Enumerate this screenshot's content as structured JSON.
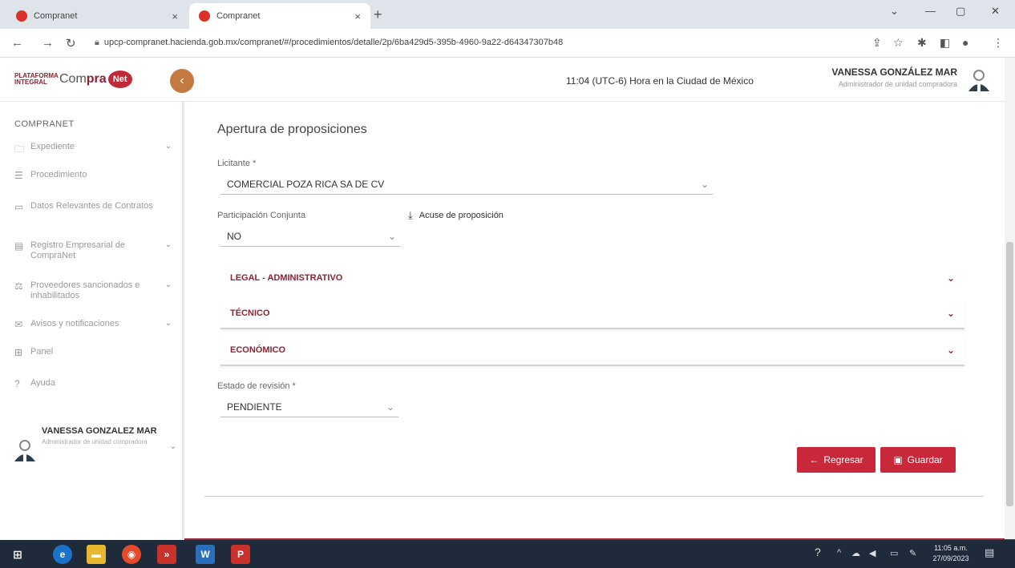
{
  "browser": {
    "tabs": [
      {
        "title": "Compranet",
        "active": false
      },
      {
        "title": "Compranet",
        "active": true
      }
    ],
    "url": "upcp-compranet.hacienda.gob.mx/compranet/#/procedimientos/detalle/2p/6ba429d5-395b-4960-9a22-d64347307b48"
  },
  "header": {
    "logo_plataforma": "PLATAFORMA INTEGRAL",
    "logo_com": "Com",
    "logo_pra": "pra",
    "logo_net": "Net",
    "clock": "11:04 (UTC-6) Hora en la Ciudad de México",
    "user_name": "VANESSA GONZÁLEZ MAR",
    "user_role": "Administrador de unidad compradora"
  },
  "sidebar": {
    "heading": "COMPRANET",
    "items": [
      {
        "label": "Expediente",
        "icon": "folder-icon",
        "chevron": true
      },
      {
        "label": "Procedimiento",
        "icon": "document-icon",
        "chevron": false
      },
      {
        "label": "Datos Relevantes de Contratos",
        "icon": "contract-icon",
        "chevron": false
      },
      {
        "label": "Registro Empresarial de CompraNet",
        "icon": "registry-icon",
        "chevron": true
      },
      {
        "label": "Proveedores sancionados e inhabilitados",
        "icon": "sanction-icon",
        "chevron": true
      },
      {
        "label": "Avisos y notificaciones",
        "icon": "message-icon",
        "chevron": true
      },
      {
        "label": "Panel",
        "icon": "panel-icon",
        "chevron": false
      },
      {
        "label": "Ayuda",
        "icon": "help-icon",
        "chevron": false
      }
    ],
    "user_name": "VANESSA GONZALEZ MAR",
    "user_role": "Administrador de unidad compradora"
  },
  "main": {
    "title": "Apertura de proposiciones",
    "licitante_label": "Licitante *",
    "licitante_value": "COMERCIAL POZA RICA SA DE CV",
    "participacion_label": "Participación Conjunta",
    "participacion_value": "NO",
    "acuse_label": "Acuse de proposición",
    "sections": [
      "LEGAL - ADMINISTRATIVO",
      "TÉCNICO",
      "ECONÓMICO"
    ],
    "estado_label": "Estado de revisión *",
    "estado_value": "PENDIENTE",
    "back_label": "Regresar",
    "save_label": "Guardar"
  },
  "taskbar": {
    "time": "11:05 a.m.",
    "date": "27/09/2023"
  },
  "colors": {
    "brand": "#8c2232",
    "button": "#c8283a",
    "collapse": "#c3793f"
  }
}
